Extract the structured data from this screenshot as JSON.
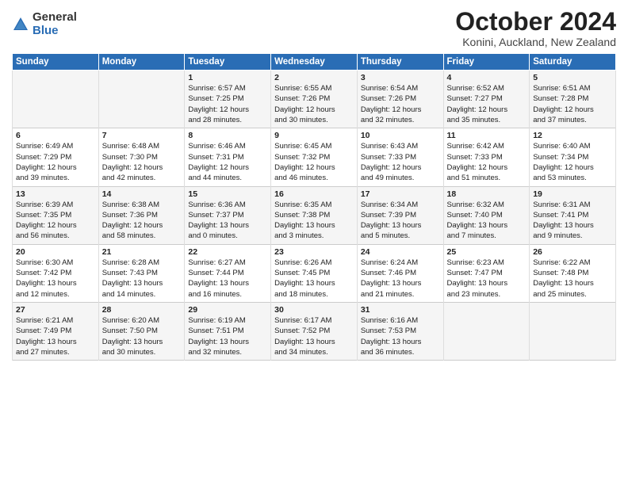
{
  "logo": {
    "general": "General",
    "blue": "Blue"
  },
  "title": "October 2024",
  "location": "Konini, Auckland, New Zealand",
  "headers": [
    "Sunday",
    "Monday",
    "Tuesday",
    "Wednesday",
    "Thursday",
    "Friday",
    "Saturday"
  ],
  "weeks": [
    [
      {
        "day": "",
        "info": ""
      },
      {
        "day": "",
        "info": ""
      },
      {
        "day": "1",
        "info": "Sunrise: 6:57 AM\nSunset: 7:25 PM\nDaylight: 12 hours\nand 28 minutes."
      },
      {
        "day": "2",
        "info": "Sunrise: 6:55 AM\nSunset: 7:26 PM\nDaylight: 12 hours\nand 30 minutes."
      },
      {
        "day": "3",
        "info": "Sunrise: 6:54 AM\nSunset: 7:26 PM\nDaylight: 12 hours\nand 32 minutes."
      },
      {
        "day": "4",
        "info": "Sunrise: 6:52 AM\nSunset: 7:27 PM\nDaylight: 12 hours\nand 35 minutes."
      },
      {
        "day": "5",
        "info": "Sunrise: 6:51 AM\nSunset: 7:28 PM\nDaylight: 12 hours\nand 37 minutes."
      }
    ],
    [
      {
        "day": "6",
        "info": "Sunrise: 6:49 AM\nSunset: 7:29 PM\nDaylight: 12 hours\nand 39 minutes."
      },
      {
        "day": "7",
        "info": "Sunrise: 6:48 AM\nSunset: 7:30 PM\nDaylight: 12 hours\nand 42 minutes."
      },
      {
        "day": "8",
        "info": "Sunrise: 6:46 AM\nSunset: 7:31 PM\nDaylight: 12 hours\nand 44 minutes."
      },
      {
        "day": "9",
        "info": "Sunrise: 6:45 AM\nSunset: 7:32 PM\nDaylight: 12 hours\nand 46 minutes."
      },
      {
        "day": "10",
        "info": "Sunrise: 6:43 AM\nSunset: 7:33 PM\nDaylight: 12 hours\nand 49 minutes."
      },
      {
        "day": "11",
        "info": "Sunrise: 6:42 AM\nSunset: 7:33 PM\nDaylight: 12 hours\nand 51 minutes."
      },
      {
        "day": "12",
        "info": "Sunrise: 6:40 AM\nSunset: 7:34 PM\nDaylight: 12 hours\nand 53 minutes."
      }
    ],
    [
      {
        "day": "13",
        "info": "Sunrise: 6:39 AM\nSunset: 7:35 PM\nDaylight: 12 hours\nand 56 minutes."
      },
      {
        "day": "14",
        "info": "Sunrise: 6:38 AM\nSunset: 7:36 PM\nDaylight: 12 hours\nand 58 minutes."
      },
      {
        "day": "15",
        "info": "Sunrise: 6:36 AM\nSunset: 7:37 PM\nDaylight: 13 hours\nand 0 minutes."
      },
      {
        "day": "16",
        "info": "Sunrise: 6:35 AM\nSunset: 7:38 PM\nDaylight: 13 hours\nand 3 minutes."
      },
      {
        "day": "17",
        "info": "Sunrise: 6:34 AM\nSunset: 7:39 PM\nDaylight: 13 hours\nand 5 minutes."
      },
      {
        "day": "18",
        "info": "Sunrise: 6:32 AM\nSunset: 7:40 PM\nDaylight: 13 hours\nand 7 minutes."
      },
      {
        "day": "19",
        "info": "Sunrise: 6:31 AM\nSunset: 7:41 PM\nDaylight: 13 hours\nand 9 minutes."
      }
    ],
    [
      {
        "day": "20",
        "info": "Sunrise: 6:30 AM\nSunset: 7:42 PM\nDaylight: 13 hours\nand 12 minutes."
      },
      {
        "day": "21",
        "info": "Sunrise: 6:28 AM\nSunset: 7:43 PM\nDaylight: 13 hours\nand 14 minutes."
      },
      {
        "day": "22",
        "info": "Sunrise: 6:27 AM\nSunset: 7:44 PM\nDaylight: 13 hours\nand 16 minutes."
      },
      {
        "day": "23",
        "info": "Sunrise: 6:26 AM\nSunset: 7:45 PM\nDaylight: 13 hours\nand 18 minutes."
      },
      {
        "day": "24",
        "info": "Sunrise: 6:24 AM\nSunset: 7:46 PM\nDaylight: 13 hours\nand 21 minutes."
      },
      {
        "day": "25",
        "info": "Sunrise: 6:23 AM\nSunset: 7:47 PM\nDaylight: 13 hours\nand 23 minutes."
      },
      {
        "day": "26",
        "info": "Sunrise: 6:22 AM\nSunset: 7:48 PM\nDaylight: 13 hours\nand 25 minutes."
      }
    ],
    [
      {
        "day": "27",
        "info": "Sunrise: 6:21 AM\nSunset: 7:49 PM\nDaylight: 13 hours\nand 27 minutes."
      },
      {
        "day": "28",
        "info": "Sunrise: 6:20 AM\nSunset: 7:50 PM\nDaylight: 13 hours\nand 30 minutes."
      },
      {
        "day": "29",
        "info": "Sunrise: 6:19 AM\nSunset: 7:51 PM\nDaylight: 13 hours\nand 32 minutes."
      },
      {
        "day": "30",
        "info": "Sunrise: 6:17 AM\nSunset: 7:52 PM\nDaylight: 13 hours\nand 34 minutes."
      },
      {
        "day": "31",
        "info": "Sunrise: 6:16 AM\nSunset: 7:53 PM\nDaylight: 13 hours\nand 36 minutes."
      },
      {
        "day": "",
        "info": ""
      },
      {
        "day": "",
        "info": ""
      }
    ]
  ]
}
